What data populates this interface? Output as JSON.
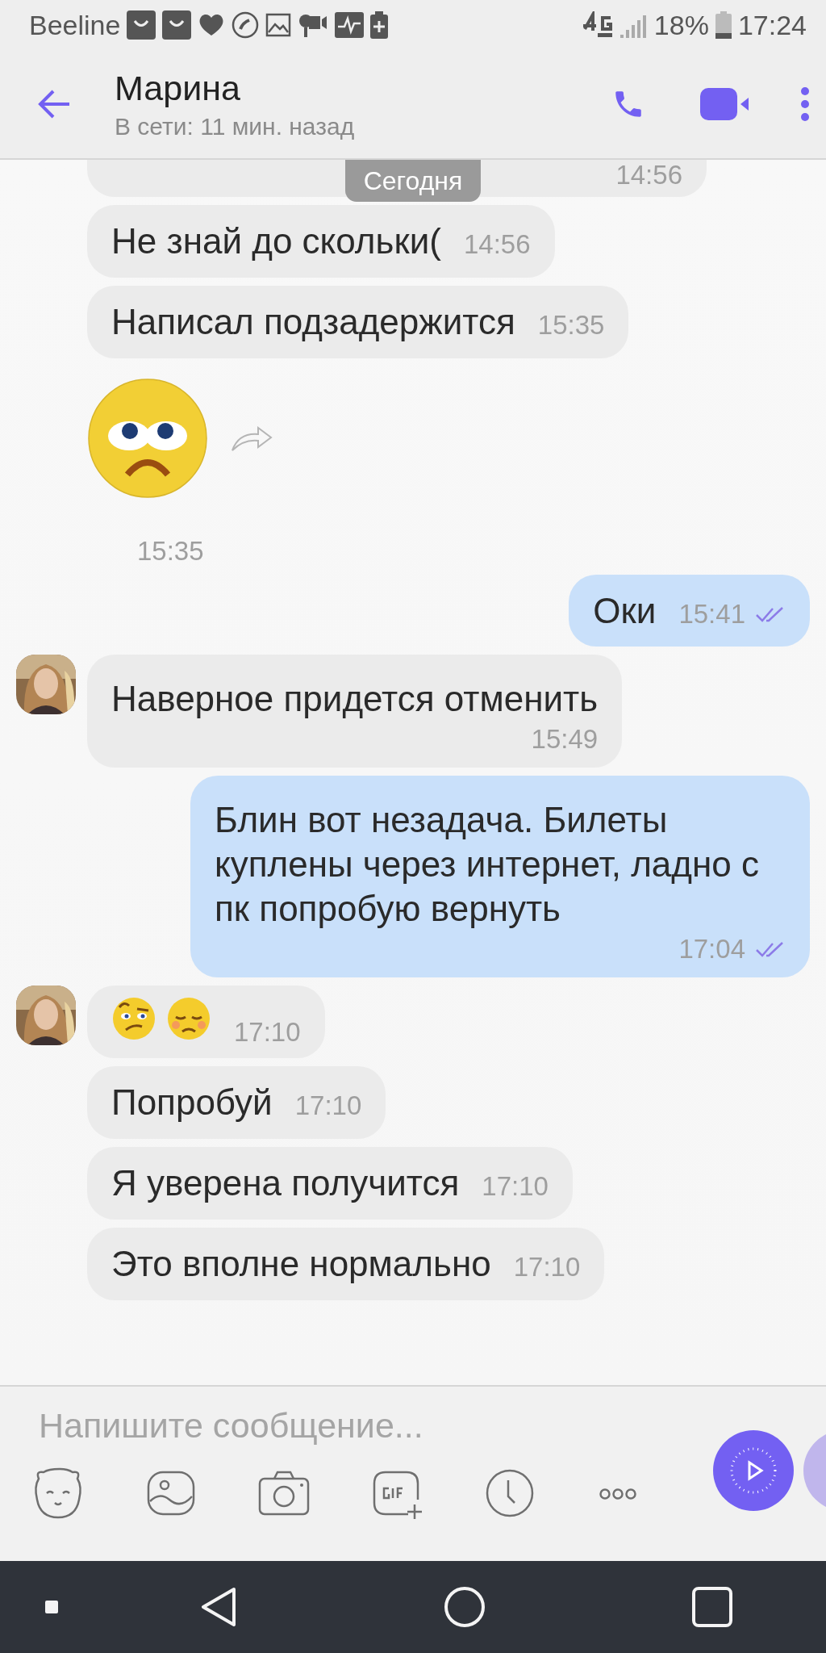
{
  "status_bar": {
    "carrier": "Beeline",
    "battery": "18%",
    "time": "17:24"
  },
  "header": {
    "title": "Марина",
    "subtitle": "В сети: 11 мин. назад"
  },
  "date_chip": "Сегодня",
  "messages": [
    {
      "kind": "partial",
      "outgoing": false,
      "time": "14:56"
    },
    {
      "kind": "text",
      "outgoing": false,
      "text": "Не знай до скольки(",
      "time": "14:56"
    },
    {
      "kind": "text",
      "outgoing": false,
      "text": "Написал подзадержится",
      "time": "15:35"
    },
    {
      "kind": "sticker",
      "outgoing": false,
      "time": "15:35"
    },
    {
      "kind": "text",
      "outgoing": true,
      "text": "Оки",
      "time": "15:41",
      "read": true
    },
    {
      "kind": "text",
      "outgoing": false,
      "avatar": true,
      "text": "Наверное придется отменить",
      "time": "15:49",
      "time_below": true
    },
    {
      "kind": "text",
      "outgoing": true,
      "text": "Блин вот незадача. Билеты куплены через интернет, ладно с пк попробую вернуть",
      "time": "17:04",
      "read": true,
      "time_below": true
    },
    {
      "kind": "emoji",
      "outgoing": false,
      "avatar": true,
      "time": "17:10"
    },
    {
      "kind": "text",
      "outgoing": false,
      "text": "Попробуй",
      "time": "17:10"
    },
    {
      "kind": "text",
      "outgoing": false,
      "text": "Я уверена получится",
      "time": "17:10"
    },
    {
      "kind": "text",
      "outgoing": false,
      "text": "Это вполне нормально",
      "time": "17:10"
    }
  ],
  "composer": {
    "placeholder": "Напишите сообщение..."
  }
}
